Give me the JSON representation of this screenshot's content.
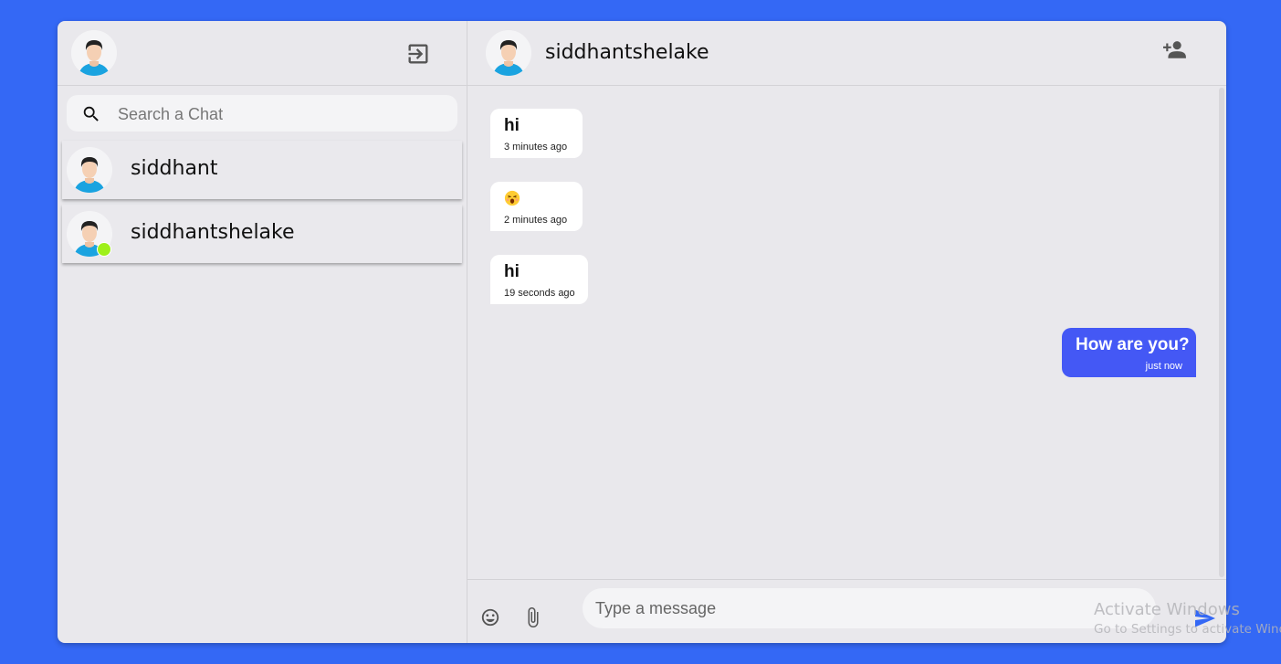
{
  "sidebar": {
    "search": {
      "placeholder": "Search a Chat"
    },
    "chats": [
      {
        "name": "siddhant",
        "online": false
      },
      {
        "name": "siddhantshelake",
        "online": true
      }
    ]
  },
  "chat": {
    "header": {
      "name": "siddhantshelake"
    },
    "messages": [
      {
        "text": "hi",
        "time": "3 minutes ago",
        "direction": "received"
      },
      {
        "text": "",
        "emoji": "astonished-face",
        "time": "2 minutes ago",
        "direction": "received"
      },
      {
        "text": "hi",
        "time": "19 seconds ago",
        "direction": "received"
      },
      {
        "text": "How are you?",
        "time": "just now",
        "direction": "sent"
      }
    ],
    "input": {
      "placeholder": "Type a message"
    }
  },
  "watermark": {
    "line1": "Activate Windows",
    "line2": "Go to Settings to activate Windows."
  },
  "colors": {
    "background": "#3468f5",
    "panel": "#e9e8ec",
    "sent_bubble": "#4458f5",
    "online_dot": "#9ef01a"
  }
}
